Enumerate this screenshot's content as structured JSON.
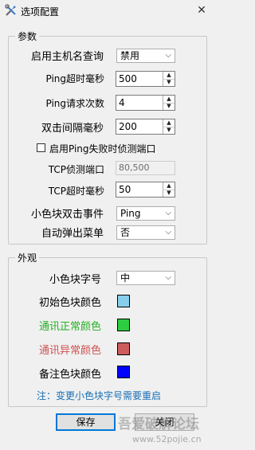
{
  "window": {
    "title": "选项配置",
    "close_glyph": "✕"
  },
  "params_group": {
    "legend": "参数",
    "host_lookup": {
      "label": "启用主机名查询",
      "value": "禁用"
    },
    "ping_timeout": {
      "label": "Ping超时毫秒",
      "value": "500"
    },
    "ping_count": {
      "label": "Ping请求次数",
      "value": "4"
    },
    "dblclick_interval": {
      "label": "双击间隔毫秒",
      "value": "200"
    },
    "ping_fail_port_check": {
      "label": "启用Ping失败时侦测端口",
      "checked": false
    },
    "tcp_ports": {
      "label": "TCP侦测端口",
      "value": "80,500"
    },
    "tcp_timeout": {
      "label": "TCP超时毫秒",
      "value": "50"
    },
    "block_dblclick": {
      "label": "小色块双击事件",
      "value": "Ping"
    },
    "auto_menu": {
      "label": "自动弹出菜单",
      "value": "否"
    }
  },
  "appearance_group": {
    "legend": "外观",
    "font_size": {
      "label": "小色块字号",
      "value": "中"
    },
    "initial_color": {
      "label": "初始色块颜色",
      "color": "#87ceeb",
      "text_color": "#000000"
    },
    "ok_color": {
      "label": "通讯正常颜色",
      "color": "#2ecc40",
      "text_color": "#22b222"
    },
    "error_color": {
      "label": "通讯异常颜色",
      "color": "#cd5c5c",
      "text_color": "#d05050"
    },
    "note_color": {
      "label": "备注色块颜色",
      "color": "#0000ff",
      "text_color": "#000000"
    },
    "note": {
      "text": "注：变更小色块字号需要重启",
      "color": "#1a6fb5"
    }
  },
  "buttons": {
    "save": "保存",
    "close": "关闭"
  },
  "watermark": {
    "site_name": "吾爱破解论坛",
    "url": "www.52pojie.cn"
  }
}
